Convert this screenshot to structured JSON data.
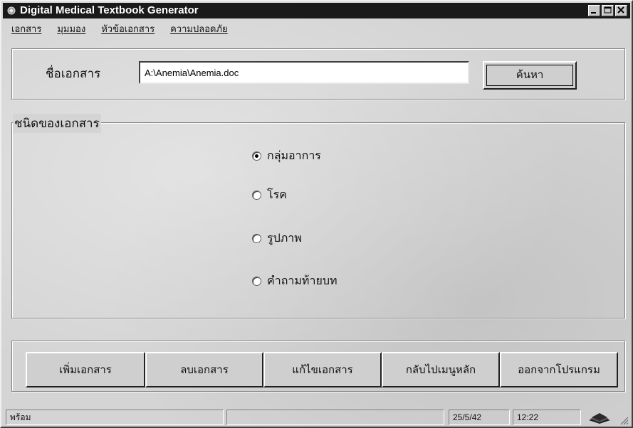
{
  "window": {
    "title": "Digital Medical Textbook Generator",
    "controls": [
      "minimize-icon",
      "maximize-icon",
      "close-icon"
    ]
  },
  "menu": {
    "items": [
      {
        "label": "เอกสาร"
      },
      {
        "label": "มุมมอง"
      },
      {
        "label": "หัวข้อเอกสาร"
      },
      {
        "label": "ความปลอดภัย"
      }
    ]
  },
  "document": {
    "name_label": "ชื่อเอกสาร",
    "path_value": "A:\\Anemia\\Anemia.doc",
    "search_label": "ค้นหา"
  },
  "doc_type": {
    "group_label": "ชนิดของเอกสาร",
    "options": [
      {
        "label": "กลุ่มอาการ",
        "checked": true
      },
      {
        "label": "โรค",
        "checked": false
      },
      {
        "label": "รูปภาพ",
        "checked": false
      },
      {
        "label": "คำถามท้ายบท",
        "checked": false
      }
    ]
  },
  "actions": {
    "add": "เพิ่มเอกสาร",
    "delete": "ลบเอกสาร",
    "edit": "แก้ไขเอกสาร",
    "back": "กลับไปเมนูหลัก",
    "exit": "ออกจากโปรแกรม"
  },
  "status": {
    "text": "พร้อม",
    "date": "25/5/42",
    "time": "12:22"
  },
  "colors": {
    "titlebar": "#1a1a1a",
    "face": "#d4d4d4"
  }
}
